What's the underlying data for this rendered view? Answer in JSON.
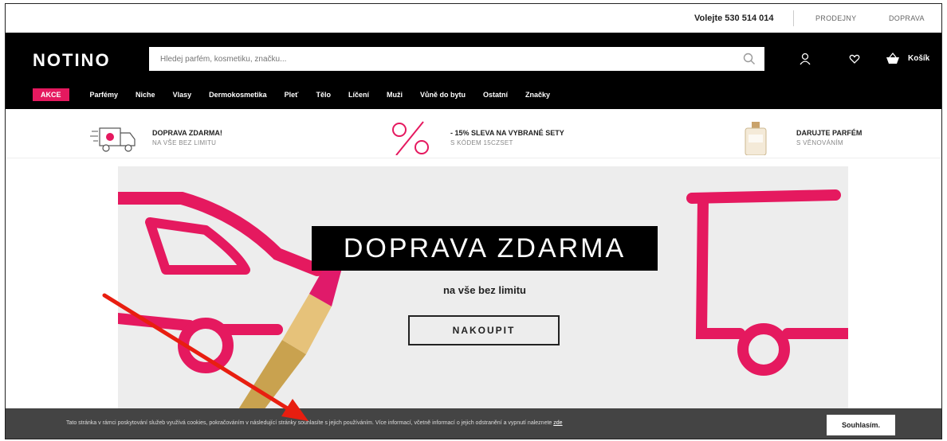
{
  "topbar": {
    "phone": "Volejte 530 514 014",
    "stores": "PRODEJNY",
    "shipping": "DOPRAVA"
  },
  "header": {
    "logo": "NOTINO",
    "search_placeholder": "Hledej parfém, kosmetiku, značku...",
    "cart_label": "Košík"
  },
  "nav": {
    "items": [
      "AKCE",
      "Parfémy",
      "Niche",
      "Vlasy",
      "Dermokosmetika",
      "Pleť",
      "Tělo",
      "Líčení",
      "Muži",
      "Vůně do bytu",
      "Ostatní",
      "Značky"
    ]
  },
  "benefits": [
    {
      "title": "DOPRAVA ZDARMA!",
      "subtitle": "NA VŠE BEZ LIMITU",
      "icon": "delivery-van-icon"
    },
    {
      "title": "- 15% SLEVA NA VYBRANÉ SETY",
      "subtitle": "S KÓDEM 15CZSET",
      "icon": "percent-icon"
    },
    {
      "title": "DARUJTE PARFÉM",
      "subtitle": "S VĚNOVÁNÍM",
      "icon": "perfume-bottle-icon"
    }
  ],
  "hero": {
    "title": "DOPRAVA ZDARMA",
    "subtitle": "na vše bez limitu",
    "cta": "NAKOUPIT"
  },
  "cookie": {
    "text": "Tato stránka v rámci poskytování služeb využívá cookies, pokračováním v následující stránky souhlasíte s jejich používáním. Více informací, včetně informací o jejich odstranění a vypnutí naleznete",
    "more_link": "zde",
    "accept": "Souhlasím."
  },
  "colors": {
    "accent": "#e5195f",
    "header_bg": "#000000",
    "cookie_bg": "#444444",
    "annotation_arrow": "#e81e10"
  }
}
